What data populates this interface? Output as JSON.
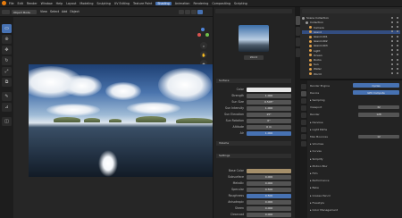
{
  "menubar": {
    "items": [
      "File",
      "Edit",
      "Render",
      "Window",
      "Help"
    ],
    "workspaces": [
      "Layout",
      "Modeling",
      "Sculpting",
      "UV Editing",
      "Texture Paint",
      "Shading",
      "Animation",
      "Rendering",
      "Compositing",
      "Scripting"
    ],
    "active_workspace": "Shading"
  },
  "viewport_header": {
    "mode": "Object Mode",
    "menus": [
      "View",
      "Select",
      "Add",
      "Object"
    ],
    "shading_buttons": [
      "wireframe",
      "solid",
      "material",
      "rendered"
    ]
  },
  "tools": [
    "select-box",
    "cursor",
    "move",
    "rotate",
    "scale",
    "transform",
    "annotate",
    "measure",
    "add-cube"
  ],
  "node_panel": {
    "preview_label": "World",
    "sections": [
      "Surface",
      "Volume",
      "Settings"
    ],
    "rows": [
      {
        "label": "Color",
        "value": ""
      },
      {
        "label": "Strength",
        "value": "1.000"
      },
      {
        "label": "Sun Size",
        "value": "0.545°"
      },
      {
        "label": "Sun Intensity",
        "value": "1.000"
      },
      {
        "label": "Sun Elevation",
        "value": "15°"
      },
      {
        "label": "Sun Rotation",
        "value": "0°"
      },
      {
        "label": "Altitude",
        "value": "0 m"
      },
      {
        "label": "Air",
        "value": "1.000"
      },
      {
        "label": "Dust",
        "value": "1.000"
      },
      {
        "label": "Ozone",
        "value": "1.000"
      }
    ],
    "lower_rows": [
      {
        "label": "Base Color",
        "value": ""
      },
      {
        "label": "Subsurface",
        "value": "0.000"
      },
      {
        "label": "Metallic",
        "value": "0.000"
      },
      {
        "label": "Specular",
        "value": "0.500"
      },
      {
        "label": "Roughness",
        "value": "0.500"
      },
      {
        "label": "Anisotropic",
        "value": "0.000"
      },
      {
        "label": "Sheen",
        "value": "0.000"
      },
      {
        "label": "Clearcoat",
        "value": "0.000"
      }
    ]
  },
  "outliner": {
    "items": [
      {
        "name": "Scene Collection",
        "color": "#9a9a9a",
        "indent": 0
      },
      {
        "name": "Collection",
        "color": "#9a9a9a",
        "indent": 1
      },
      {
        "name": "Camera",
        "color": "#e0a04a",
        "indent": 2
      },
      {
        "name": "Island",
        "color": "#e0a04a",
        "indent": 2
      },
      {
        "name": "Island.001",
        "color": "#e0a04a",
        "indent": 2
      },
      {
        "name": "Island.002",
        "color": "#e0a04a",
        "indent": 2
      },
      {
        "name": "Island.003",
        "color": "#e0a04a",
        "indent": 2
      },
      {
        "name": "Light",
        "color": "#e0a04a",
        "indent": 2
      },
      {
        "name": "Ocean",
        "color": "#e0a04a",
        "indent": 2
      },
      {
        "name": "Rocks",
        "color": "#e0a04a",
        "indent": 2
      },
      {
        "name": "Sun",
        "color": "#e0a04a",
        "indent": 2
      },
      {
        "name": "Water",
        "color": "#e0a04a",
        "indent": 2
      },
      {
        "name": "World",
        "color": "#e0a04a",
        "indent": 2
      }
    ],
    "selected_index": 3
  },
  "properties": {
    "rows": [
      {
        "label": "Render Engine",
        "value": "Cycles"
      },
      {
        "label": "Device",
        "value": "GPU Compute"
      },
      {
        "label": "Sampling",
        "value": ""
      },
      {
        "label": "Viewport",
        "value": "32"
      },
      {
        "label": "Render",
        "value": "128"
      },
      {
        "label": "Denoise",
        "value": ""
      },
      {
        "label": "Light Paths",
        "value": ""
      },
      {
        "label": "Max Bounces",
        "value": "12"
      },
      {
        "label": "Volumes",
        "value": ""
      },
      {
        "label": "Curves",
        "value": ""
      },
      {
        "label": "Simplify",
        "value": ""
      },
      {
        "label": "Motion Blur",
        "value": ""
      },
      {
        "label": "Film",
        "value": ""
      },
      {
        "label": "Performance",
        "value": ""
      },
      {
        "label": "Bake",
        "value": ""
      },
      {
        "label": "Grease Pencil",
        "value": ""
      },
      {
        "label": "Freestyle",
        "value": ""
      },
      {
        "label": "Color Management",
        "value": ""
      }
    ]
  },
  "colors": {
    "accent": "#4772b3",
    "object_orange": "#e0a04a",
    "panel_bg": "#232323"
  }
}
